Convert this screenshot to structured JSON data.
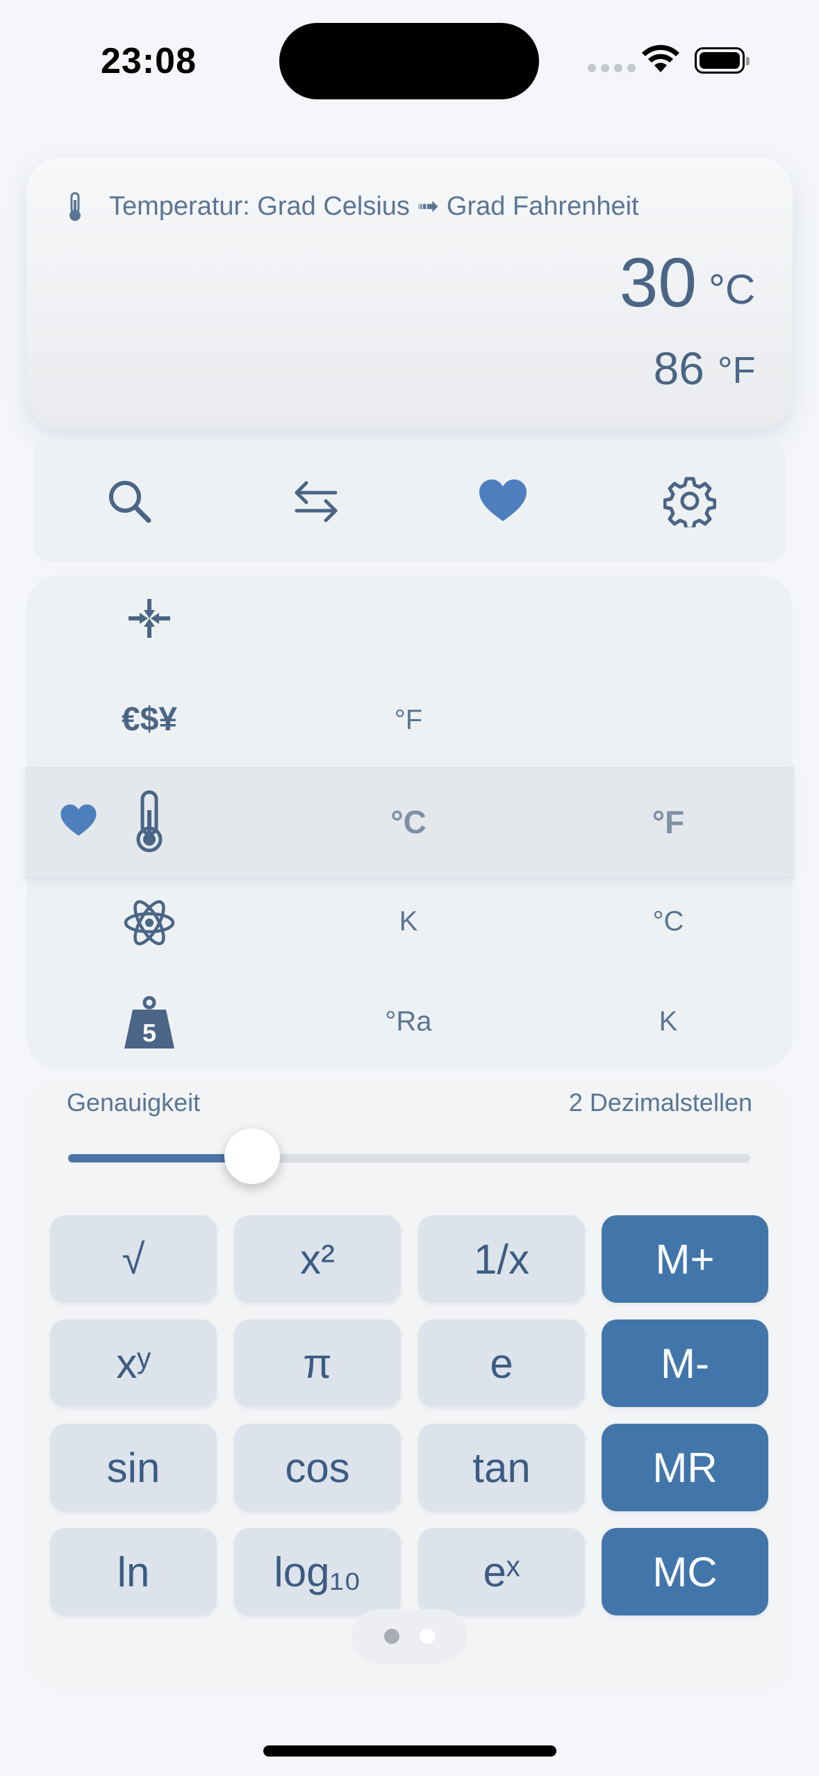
{
  "status_bar": {
    "time": "23:08"
  },
  "display": {
    "title": "Temperatur: Grad Celsius ➟ Grad Fahrenheit",
    "input_value": "30",
    "input_unit": "°C",
    "output_value": "86",
    "output_unit": "°F"
  },
  "toolbar": {
    "icons": [
      "search-icon",
      "swap-icon",
      "heart-icon",
      "gear-icon"
    ]
  },
  "picker": {
    "rows": [
      {
        "icon": "compress-arrows-icon",
        "from": "",
        "to": ""
      },
      {
        "icon": "currency-icon",
        "icon_text": "€$¥",
        "from": "°F",
        "to": ""
      },
      {
        "icon": "thermometer-icon",
        "from": "°C",
        "to": "°F",
        "selected": true,
        "favorite": true
      },
      {
        "icon": "atom-icon",
        "from": "K",
        "to": "°C"
      },
      {
        "icon": "weight-icon",
        "icon_text": "5",
        "from": "°Ra",
        "to": "K"
      }
    ]
  },
  "precision": {
    "label": "Genauigkeit",
    "value_text": "2 Dezimalstellen",
    "slider_fraction": 0.27
  },
  "keypad": {
    "rows": [
      [
        "√",
        "x²",
        "1/x",
        "M+"
      ],
      [
        "xʸ",
        "π",
        "e",
        "M-"
      ],
      [
        "sin",
        "cos",
        "tan",
        "MR"
      ],
      [
        "ln",
        "log₁₀",
        "eˣ",
        "MC"
      ]
    ]
  },
  "pager": {
    "count": 2,
    "active": 1
  },
  "colors": {
    "accent": "#4276ab",
    "text": "#4a6585",
    "heart": "#4d7fbf"
  }
}
